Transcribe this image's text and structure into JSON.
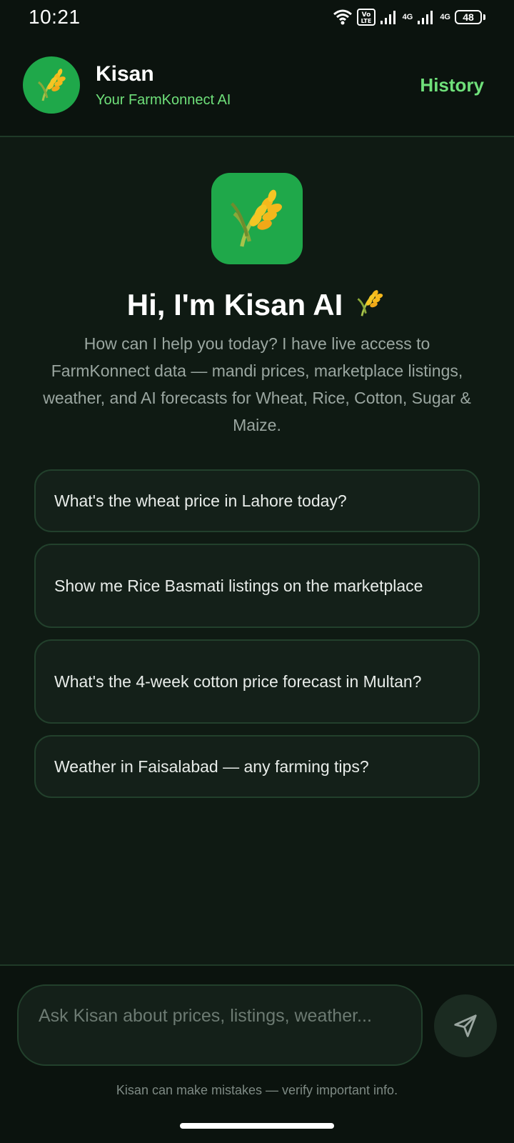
{
  "status_bar": {
    "time": "10:21",
    "network_label_1": "4G",
    "network_label_2": "4G",
    "volte_label": "Vo LTE",
    "battery": "48"
  },
  "header": {
    "title": "Kisan",
    "subtitle": "Your FarmKonnect AI",
    "history_label": "History",
    "avatar_icon": "wheat-icon"
  },
  "hero": {
    "logo_icon": "wheat-icon",
    "title": "Hi, I'm Kisan AI",
    "title_emoji": "🌾",
    "description": "How can I help you today? I have live access to FarmKonnect data — mandi prices, marketplace listings, weather, and AI forecasts for Wheat, Rice, Cotton, Sugar & Maize."
  },
  "suggestions": [
    {
      "label": "What's the wheat price in Lahore today?"
    },
    {
      "label": "Show me Rice Basmati listings on the marketplace"
    },
    {
      "label": "What's the 4-week cotton price forecast in Multan?"
    },
    {
      "label": "Weather in Faisalabad — any farming tips?"
    }
  ],
  "composer": {
    "placeholder": "Ask Kisan about prices, listings, weather...",
    "send_icon": "send-icon",
    "disclaimer": "Kisan can make mistakes — verify important info."
  },
  "colors": {
    "accent": "#6fe07a",
    "brand_green": "#1fa84a",
    "background": "#0f1a13"
  }
}
